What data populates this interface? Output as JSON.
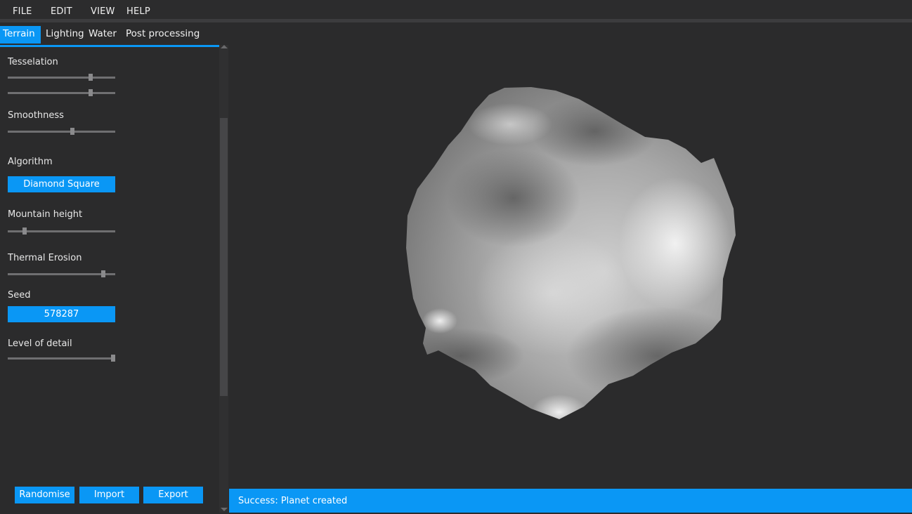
{
  "menu": [
    "FILE",
    "EDIT",
    "VIEW",
    "HELP"
  ],
  "tabs": [
    "Terrain",
    "Lighting",
    "Water",
    "Post processing"
  ],
  "active_tab": "Terrain",
  "controls": {
    "tesselation_label": "Tesselation",
    "tesselation_values": [
      0.77,
      0.77
    ],
    "smoothness_label": "Smoothness",
    "smoothness_value": 0.6,
    "algorithm_label": "Algorithm",
    "algorithm_value": "Diamond Square",
    "mountain_height_label": "Mountain height",
    "mountain_height_value": 0.16,
    "thermal_erosion_label": "Thermal Erosion",
    "thermal_erosion_value": 0.89,
    "seed_label": "Seed",
    "seed_value": "578287",
    "lod_label": "Level of detail",
    "lod_value": 0.98
  },
  "buttons": {
    "randomise": "Randomise",
    "import": "Import",
    "export": "Export"
  },
  "status": "Success: Planet created",
  "colors": {
    "accent": "#0a97f5",
    "background": "#2b2b2c"
  }
}
